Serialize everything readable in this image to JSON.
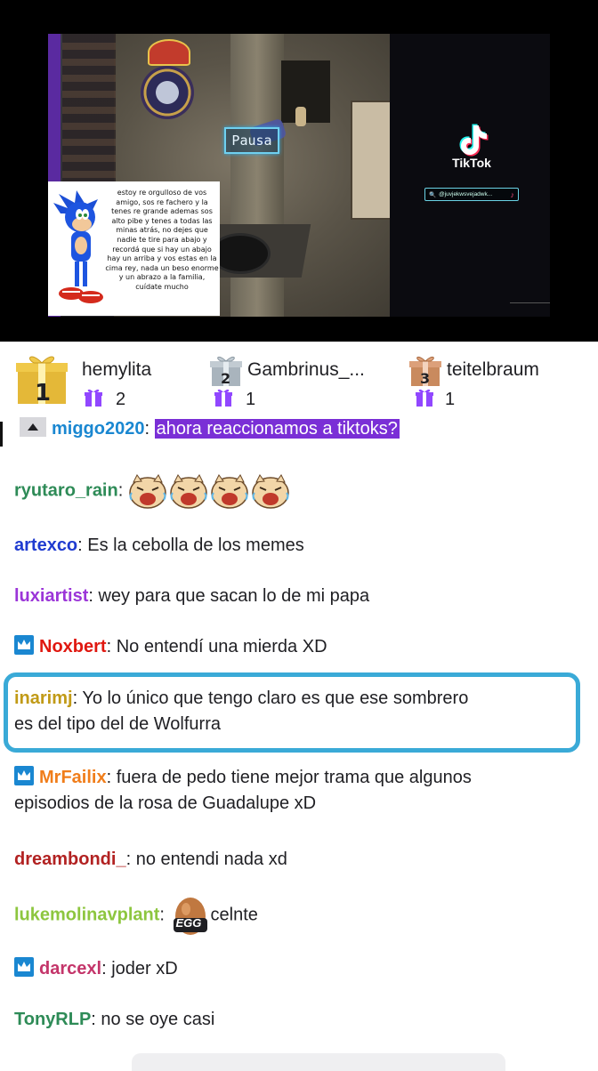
{
  "video": {
    "pause_label": "Pausa",
    "sonic_message": "estoy re orgulloso de vos amigo, sos re fachero y la tenes re grande ademas sos alto pibe y tenes a todas las minas atrás, no dejes que nadie te tire para abajo y recordá que si hay un abajo hay un arriba y vos estas en la cima rey, nada un beso enorme y un abrazo a la familia, cuídate mucho",
    "tiktok_label": "TikTok",
    "tiktok_handle": "@juvjekwsvejadwk..."
  },
  "gifters": [
    {
      "rank": "1",
      "name": "hemylita",
      "count": "2",
      "color": "#e4b838"
    },
    {
      "rank": "2",
      "name": "Gambrinus_...",
      "count": "1",
      "color": "#a9b4bd"
    },
    {
      "rank": "3",
      "name": "teitelbraum",
      "count": "1",
      "color": "#c98a5e"
    }
  ],
  "chat": {
    "messages": [
      {
        "user": "miggo2020",
        "text": "ahora reaccionamos a tiktoks?",
        "color": "#1a87d1"
      },
      {
        "user": "ryutaro_rain",
        "text": "",
        "color": "#2e8b57"
      },
      {
        "user": "artexco",
        "text": "Es la cebolla de los memes",
        "color": "#1f3bd0"
      },
      {
        "user": "luxiartist",
        "text": "wey para que sacan lo de mi papa",
        "color": "#9b35d8"
      },
      {
        "user": "Noxbert",
        "text": "No entendí una mierda XD",
        "color": "#e0170f"
      },
      {
        "user": "inarimj",
        "text_line1": "Yo lo único que tengo claro es que ese sombrero",
        "text_line2": "es del tipo del de Wolfurra",
        "color": "#c19a16"
      },
      {
        "user": "MrFailix",
        "text_line1": "fuera de pedo tiene mejor trama que algunos",
        "text_line2": "episodios de la rosa de Guadalupe xD",
        "color": "#f07d1a"
      },
      {
        "user": "dreambondi_",
        "text": "no entendi nada xd",
        "color": "#b22222"
      },
      {
        "user": "lukemolinavplant",
        "text": "celnte",
        "color": "#8dc63f"
      },
      {
        "user": "darcexl",
        "text": "joder xD",
        "color": "#c4356a"
      },
      {
        "user": "TonyRLP",
        "text": "no se oye casi",
        "color": "#2e8b57"
      }
    ],
    "separator": ": "
  },
  "emotes": {
    "egg_label": "EGG"
  },
  "colors": {
    "highlight": "#3aaad7",
    "badge": "#1a87d1",
    "gift_purple": "#9147ff"
  }
}
